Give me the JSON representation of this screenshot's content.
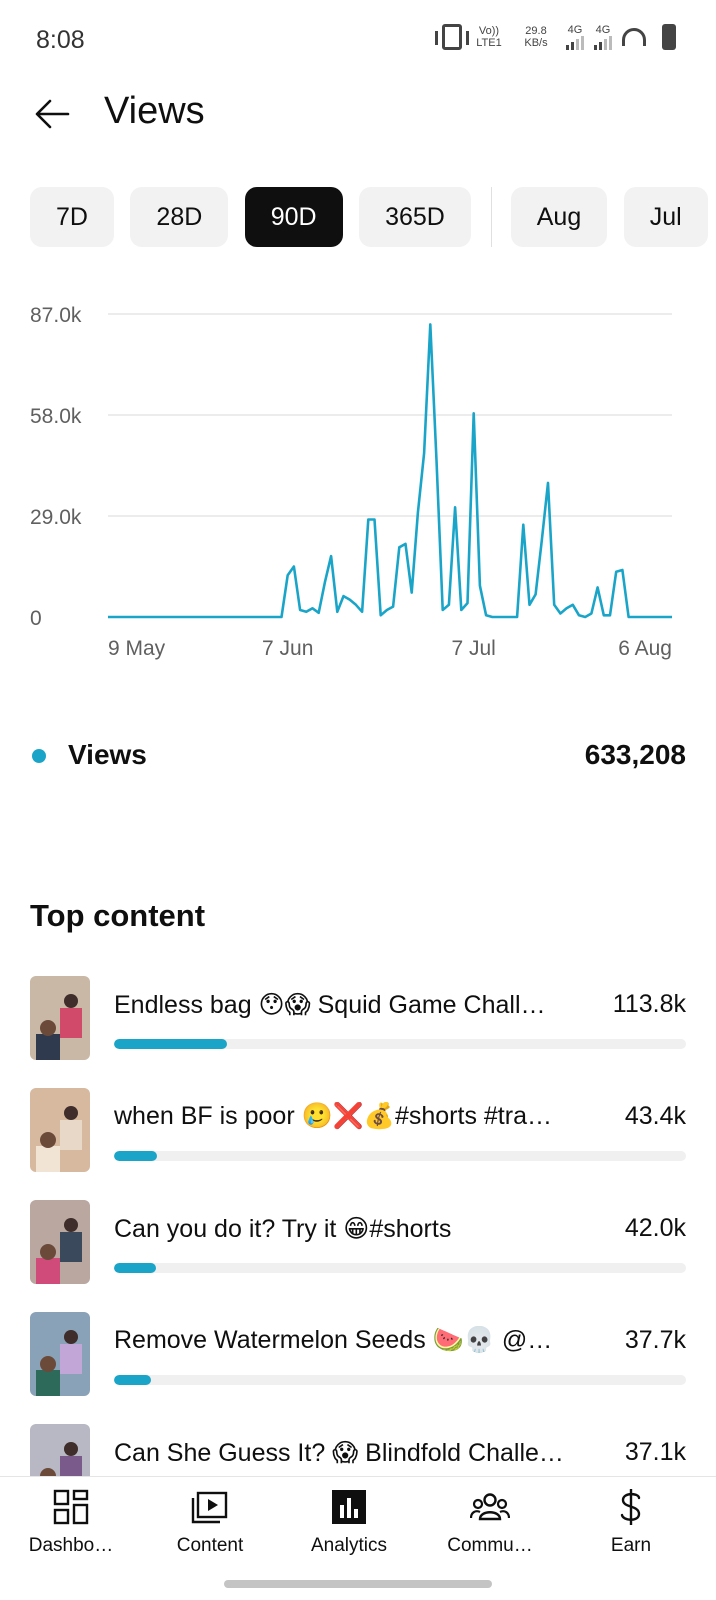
{
  "status_bar": {
    "time": "8:08",
    "volte": "Vo)) LTE1",
    "speed": "29.8 KB/s",
    "network1": "4G",
    "network2": "4G"
  },
  "header": {
    "title": "Views",
    "back_icon": "arrow-left-icon"
  },
  "chips": [
    {
      "label": "7D",
      "active": false
    },
    {
      "label": "28D",
      "active": false
    },
    {
      "label": "90D",
      "active": true
    },
    {
      "label": "365D",
      "active": false
    },
    {
      "label": "Aug",
      "active": false
    },
    {
      "label": "Jul",
      "active": false
    }
  ],
  "chart_data": {
    "type": "line",
    "title": "",
    "xlabel": "",
    "ylabel": "",
    "x_tick_labels": [
      "9 May",
      "7 Jun",
      "7 Jul",
      "6 Aug"
    ],
    "y_tick_labels": [
      "87.0k",
      "58.0k",
      "29.0k",
      "0"
    ],
    "ylim": [
      0,
      87000
    ],
    "grid": true,
    "color": "#1aa5c8",
    "series": [
      {
        "values": [
          0,
          0,
          0,
          0,
          0,
          0,
          0,
          0,
          0,
          0,
          0,
          0,
          0,
          0,
          0,
          0,
          0,
          0,
          0,
          0,
          0,
          0,
          0,
          0,
          0,
          0,
          0,
          0,
          0,
          12000,
          14500,
          2000,
          1500,
          2500,
          1200,
          10000,
          17500,
          1500,
          6000,
          5000,
          3500,
          1500,
          28000,
          28000,
          500,
          2000,
          3000,
          20000,
          21000,
          7000,
          30000,
          47000,
          84000,
          45000,
          2000,
          3500,
          31500,
          2000,
          4000,
          58500,
          9000,
          500,
          0,
          0,
          0,
          0,
          0,
          26500,
          3500,
          6500,
          22000,
          38500,
          3500,
          1000,
          2500,
          3500,
          500,
          0,
          1000,
          8500,
          500,
          500,
          13000,
          13500,
          0,
          0,
          0,
          0,
          0,
          0,
          0,
          0
        ]
      }
    ]
  },
  "summary": {
    "label": "Views",
    "value": "633,208",
    "dot_color": "#1aa5c8"
  },
  "top_content": {
    "title": "Top content",
    "items": [
      {
        "title": "Endless bag 😯😱 Squid Game Chall…",
        "value": "113.8k",
        "share": 0.197
      },
      {
        "title": "when BF is poor 🥲❌💰#shorts #tra…",
        "value": "43.4k",
        "share": 0.075
      },
      {
        "title": "Can you do it? Try it 😁#shorts",
        "value": "42.0k",
        "share": 0.073
      },
      {
        "title": "Remove Watermelon Seeds 🍉💀 @…",
        "value": "37.7k",
        "share": 0.065
      },
      {
        "title": "Can She Guess It? 😱 Blindfold Challe…",
        "value": "37.1k",
        "share": 0.064
      }
    ]
  },
  "bottom_nav": [
    {
      "label": "Dashbo…",
      "icon": "dashboard-icon"
    },
    {
      "label": "Content",
      "icon": "content-play-icon"
    },
    {
      "label": "Analytics",
      "icon": "analytics-icon",
      "active": true
    },
    {
      "label": "Commu…",
      "icon": "community-icon"
    },
    {
      "label": "Earn",
      "icon": "dollar-icon"
    }
  ]
}
